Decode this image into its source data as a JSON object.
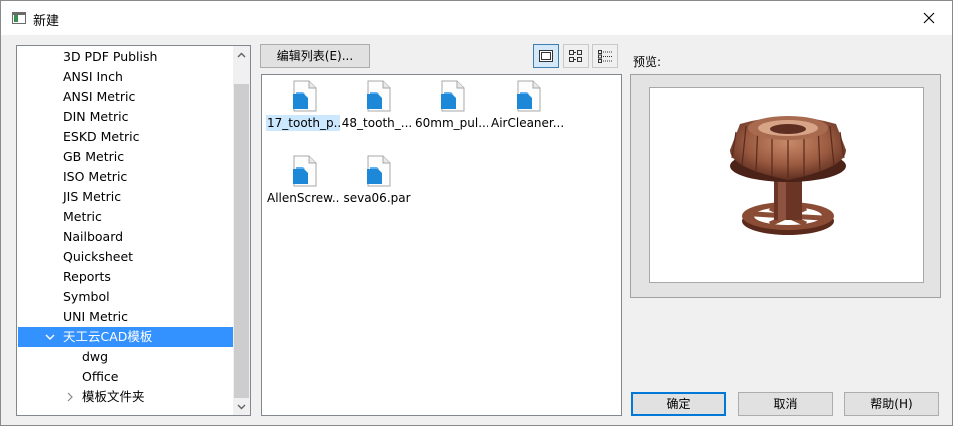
{
  "window": {
    "title": "新建"
  },
  "tree": {
    "items": [
      {
        "label": "3D PDF Publish"
      },
      {
        "label": "ANSI Inch"
      },
      {
        "label": "ANSI Metric"
      },
      {
        "label": "DIN Metric"
      },
      {
        "label": "ESKD Metric"
      },
      {
        "label": "GB Metric"
      },
      {
        "label": "ISO Metric"
      },
      {
        "label": "JIS Metric"
      },
      {
        "label": "Metric"
      },
      {
        "label": "Nailboard"
      },
      {
        "label": "Quicksheet"
      },
      {
        "label": "Reports"
      },
      {
        "label": "Symbol"
      },
      {
        "label": "UNI Metric"
      },
      {
        "label": "天工云CAD模板",
        "expanded": true,
        "selected": true
      },
      {
        "label": "dwg"
      },
      {
        "label": "Office"
      },
      {
        "label": "模板文件夹",
        "collapsed": true
      }
    ]
  },
  "toolbar": {
    "edit_list_label": "编辑列表(E)..."
  },
  "files": [
    {
      "name": "17_tooth_p...",
      "selected": true
    },
    {
      "name": "48_tooth_..."
    },
    {
      "name": "60mm_pul..."
    },
    {
      "name": "AirCleaner..."
    },
    {
      "name": "AllenScrew..."
    },
    {
      "name": "seva06.par"
    }
  ],
  "preview": {
    "label": "预览:"
  },
  "buttons": {
    "ok": "确定",
    "cancel": "取消",
    "help": "帮助(H)"
  },
  "colors": {
    "selection": "#3392ff",
    "accent": "#0078d7",
    "file_icon": "#1e88d8",
    "gear": "#8b4a36"
  }
}
